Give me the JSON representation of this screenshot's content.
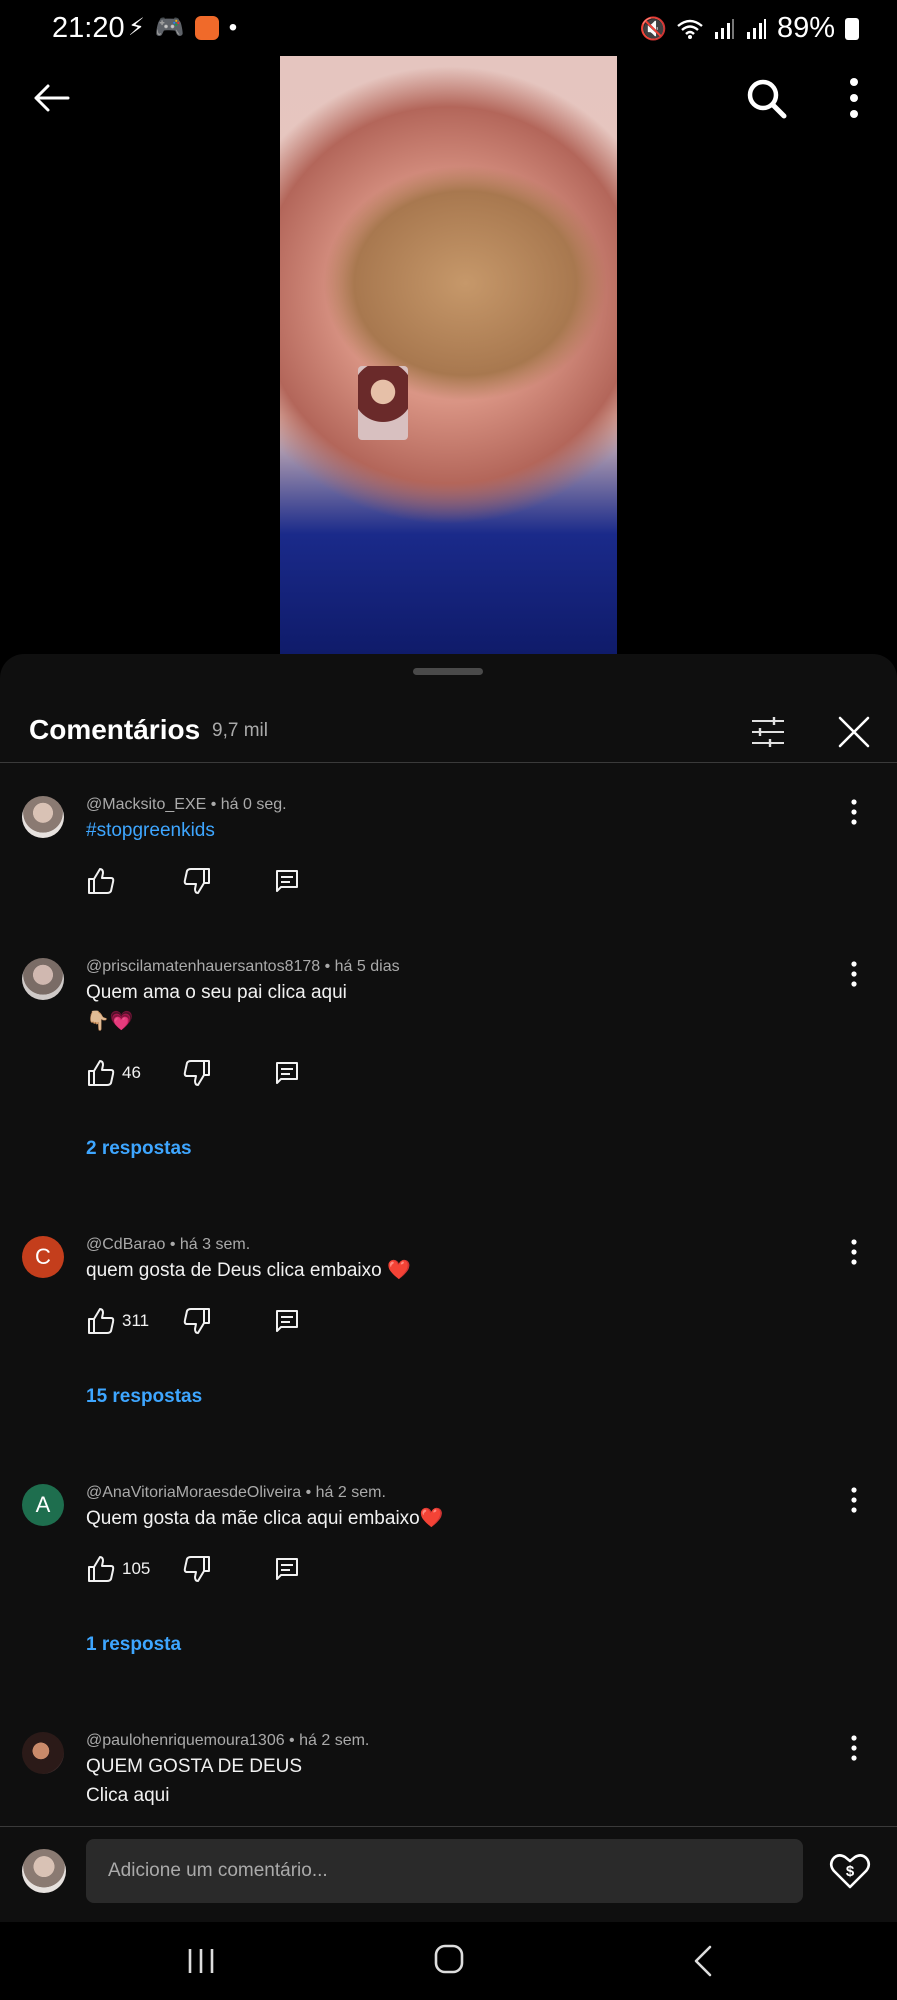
{
  "status_bar": {
    "time": "21:20",
    "battery": "89%",
    "left_icons": [
      "flash-icon",
      "gamepad-icon",
      "app-icon",
      "dot-icon"
    ],
    "right_icons": [
      "battery-saver-icon",
      "mute-icon",
      "wifi-icon",
      "signal-icon",
      "signal-icon",
      "battery-icon"
    ]
  },
  "sheet": {
    "title": "Comentários",
    "count": "9,7 mil"
  },
  "comments": [
    {
      "meta": "@Macksito_EXE • há 0 seg.",
      "text": "#stopgreenkids",
      "likes": "",
      "replies": ""
    },
    {
      "meta": "@priscilamatenhauersantos8178 • há 5 dias",
      "text": "Quem ama o seu pai clica aqui",
      "text2": "👇🏼💗",
      "likes": "46",
      "replies": "2 respostas"
    },
    {
      "avatar_letter": "C",
      "avatar_color": "#c43e1c",
      "meta": "@CdBarao • há 3 sem.",
      "text": "quem gosta de Deus clica  embaixo ❤️",
      "likes": "311",
      "replies": "15 respostas"
    },
    {
      "avatar_letter": "A",
      "avatar_color": "#1e6e4e",
      "meta": "@AnaVitoriaMoraesdeOliveira • há 2 sem.",
      "text": "Quem gosta da mãe clica aqui embaixo❤️",
      "likes": "105",
      "replies": "1 resposta"
    },
    {
      "meta": "@paulohenriquemoura1306 • há 2 sem.",
      "text": "QUEM GOSTA DE DEUS",
      "text2": "Clica aqui"
    }
  ],
  "input": {
    "placeholder": "Adicione um comentário..."
  }
}
